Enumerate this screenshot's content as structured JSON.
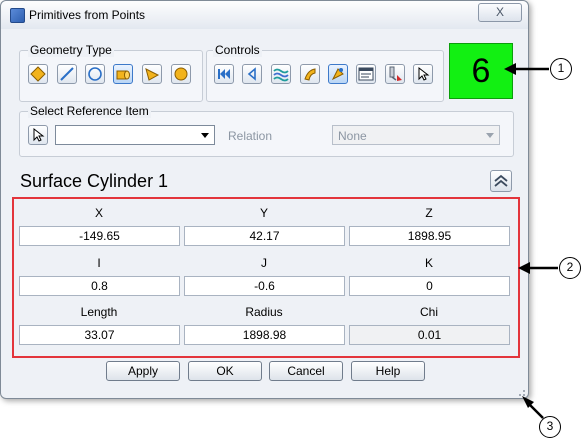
{
  "window": {
    "title": "Primitives from Points",
    "close_glyph": "X"
  },
  "geometry_type": {
    "label": "Geometry Type",
    "buttons": [
      "plane-icon",
      "line-icon",
      "circle-icon",
      "cylinder-icon",
      "cone-icon",
      "sphere-icon"
    ]
  },
  "controls": {
    "label": "Controls",
    "buttons": [
      "first-icon",
      "previous-icon",
      "surface-wave-icon",
      "curve-icon",
      "pick-point-icon",
      "display-icon",
      "probe-icon",
      "cursor-icon"
    ]
  },
  "counter": {
    "value": "6",
    "color": "#12f012"
  },
  "reference": {
    "label": "Select Reference Item",
    "selected": "",
    "relation_label": "Relation",
    "relation_value": "None"
  },
  "section": {
    "title": "Surface Cylinder 1"
  },
  "fields": {
    "x": {
      "label": "X",
      "value": "-149.65"
    },
    "y": {
      "label": "Y",
      "value": "42.17"
    },
    "z": {
      "label": "Z",
      "value": "1898.95"
    },
    "i": {
      "label": "I",
      "value": "0.8"
    },
    "j": {
      "label": "J",
      "value": "-0.6"
    },
    "k": {
      "label": "K",
      "value": "0"
    },
    "length": {
      "label": "Length",
      "value": "33.07"
    },
    "radius": {
      "label": "Radius",
      "value": "1898.98"
    },
    "chi": {
      "label": "Chi",
      "value": "0.01"
    }
  },
  "buttons": {
    "apply": "Apply",
    "ok": "OK",
    "cancel": "Cancel",
    "help": "Help"
  },
  "callouts": [
    "1",
    "2",
    "3"
  ],
  "colors": {
    "highlight_box": "#e3353c",
    "accent": "#3d79c9"
  }
}
